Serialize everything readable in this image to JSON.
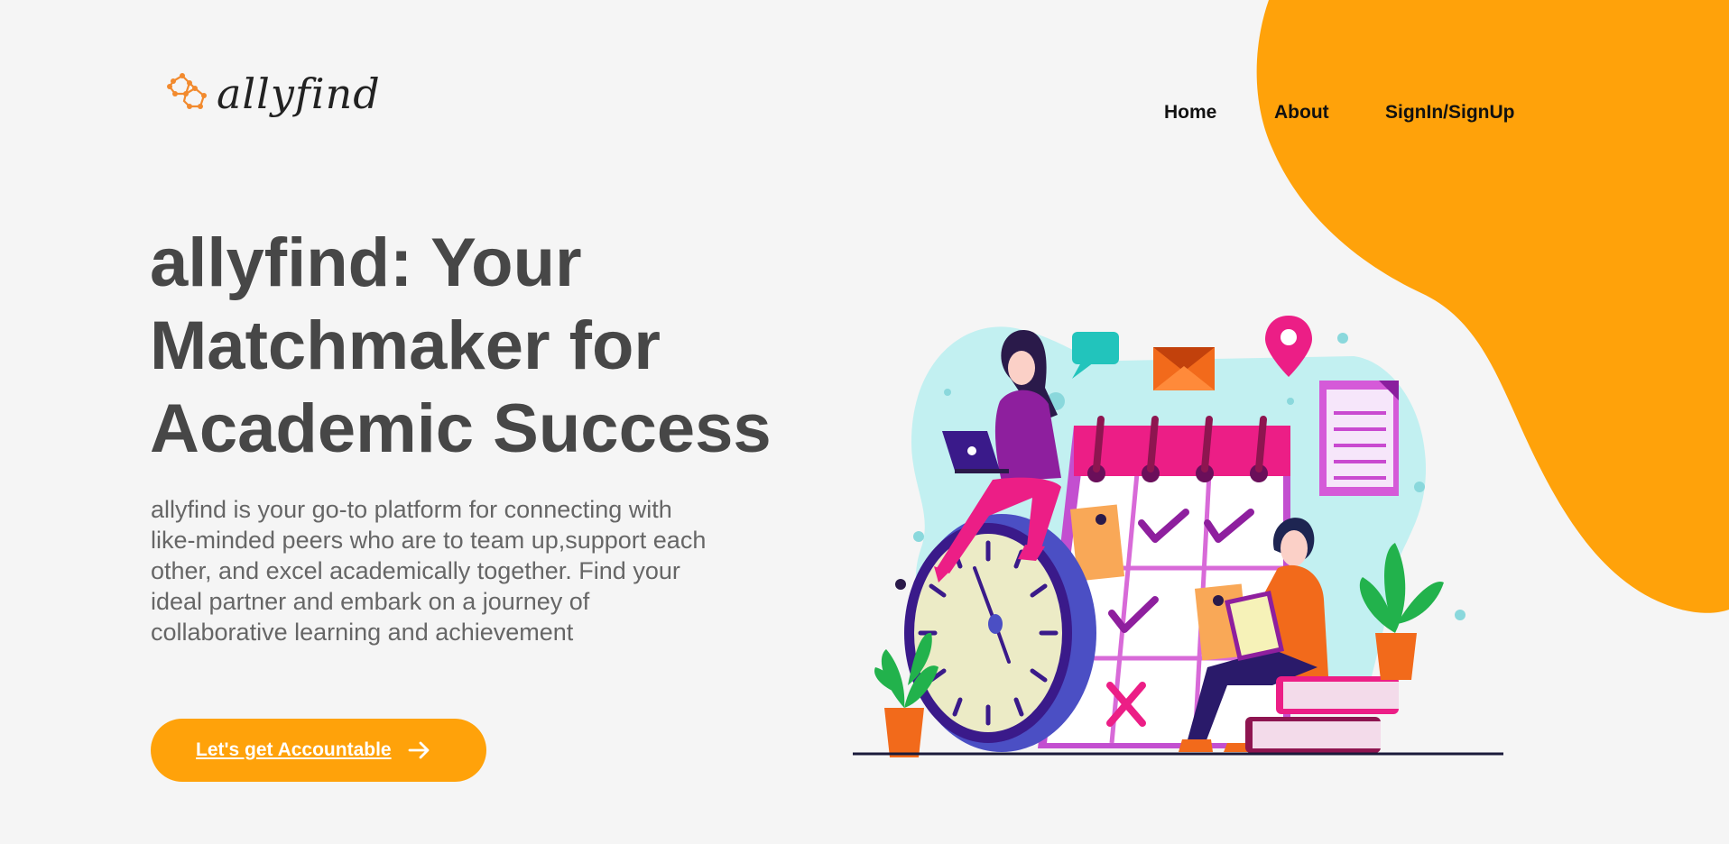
{
  "brand": {
    "name": "allyfind",
    "logo_icon": "molecule-icon"
  },
  "nav": {
    "home": "Home",
    "about": "About",
    "signin": "SignIn/SignUp"
  },
  "hero": {
    "title": "allyfind: Your Matchmaker for Academic Success",
    "description": "allyfind is your go-to platform for connecting with like-minded peers who are to team up,support each other, and excel academically together. Find your ideal partner and embark on a journey of collaborative learning and achievement",
    "cta_label": "Let's get Accountable",
    "cta_icon": "arrow-right-icon"
  },
  "colors": {
    "accent": "#ffa20a",
    "background": "#f5f5f5",
    "heading": "#474747",
    "body_text": "#666666",
    "pink": "#e91e8c",
    "purple": "#8e1fa0"
  }
}
